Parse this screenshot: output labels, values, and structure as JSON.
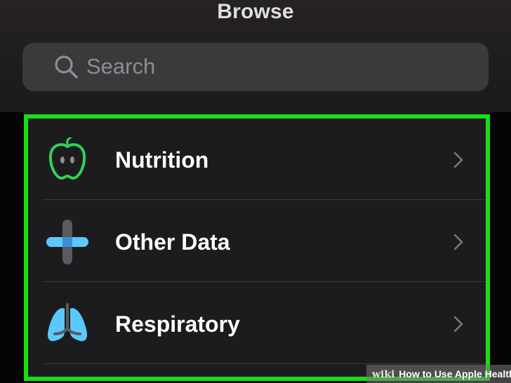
{
  "header": {
    "title": "Browse"
  },
  "search": {
    "placeholder": "Search",
    "icon": "search-icon"
  },
  "categories": [
    {
      "label": "Nutrition",
      "icon": "apple-icon",
      "color": "#30d158"
    },
    {
      "label": "Other Data",
      "icon": "medical-cross-icon",
      "color": "#5ac8fa"
    },
    {
      "label": "Respiratory",
      "icon": "lungs-icon",
      "color": "#5ac8fa"
    }
  ],
  "colors": {
    "background": "#000000",
    "card": "#1c1c1e",
    "highlight": "#14e012",
    "search_field": "#3a3a3c"
  },
  "watermark": {
    "brand": "wiki",
    "caption": "How to Use Apple Health"
  }
}
